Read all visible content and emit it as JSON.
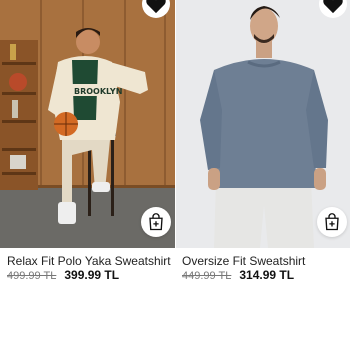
{
  "products": [
    {
      "title": "Relax Fit Polo Yaka Sweatshirt",
      "old_price": "499.99 TL",
      "price": "399.99 TL",
      "favorite_icon": "heart-icon",
      "cart_icon": "shopping-bag-add-icon"
    },
    {
      "title": "Oversize Fit Sweatshirt",
      "old_price": "449.99 TL",
      "price": "314.99 TL",
      "favorite_icon": "heart-icon",
      "cart_icon": "shopping-bag-add-icon"
    }
  ],
  "colors": {
    "price_text": "#111111",
    "old_price_text": "#777777",
    "background": "#ffffff"
  }
}
